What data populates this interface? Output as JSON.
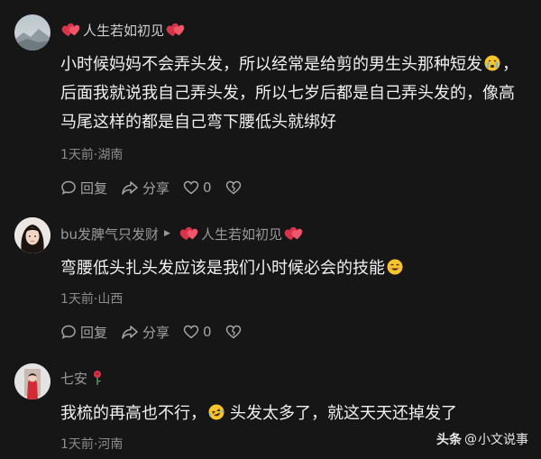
{
  "comments": [
    {
      "name": "人生若如初见",
      "text_1": "小时候妈妈不会弄头发，所以经常是给剪的男生头那种短发",
      "text_2": "，后面我就说我自己弄头发，所以七岁后都是自己弄头发的，像高马尾这样的都是自己弯下腰低头就绑好",
      "meta": "1天前·湖南",
      "reply_label": "回复",
      "share_label": "分享",
      "like_count": "0"
    },
    {
      "name": "bu发脾气只发财",
      "reply_to": "人生若如初见",
      "text": "弯腰低头扎头发应该是我们小时候必会的技能",
      "meta": "1天前·山西",
      "reply_label": "回复",
      "share_label": "分享",
      "like_count": "0"
    },
    {
      "name": "七安",
      "text_1": "我梳的再高也不行，",
      "text_2": "头发太多了，就这天天还掉发了",
      "meta": "1天前·河南"
    }
  ],
  "watermark": {
    "brand": "头条",
    "sep": "@",
    "author": "小文说事"
  },
  "colors": {
    "background": "#161616",
    "heart_red": "#d8334a",
    "text_primary": "#f0f0f0",
    "text_secondary": "#8c8c8c"
  }
}
